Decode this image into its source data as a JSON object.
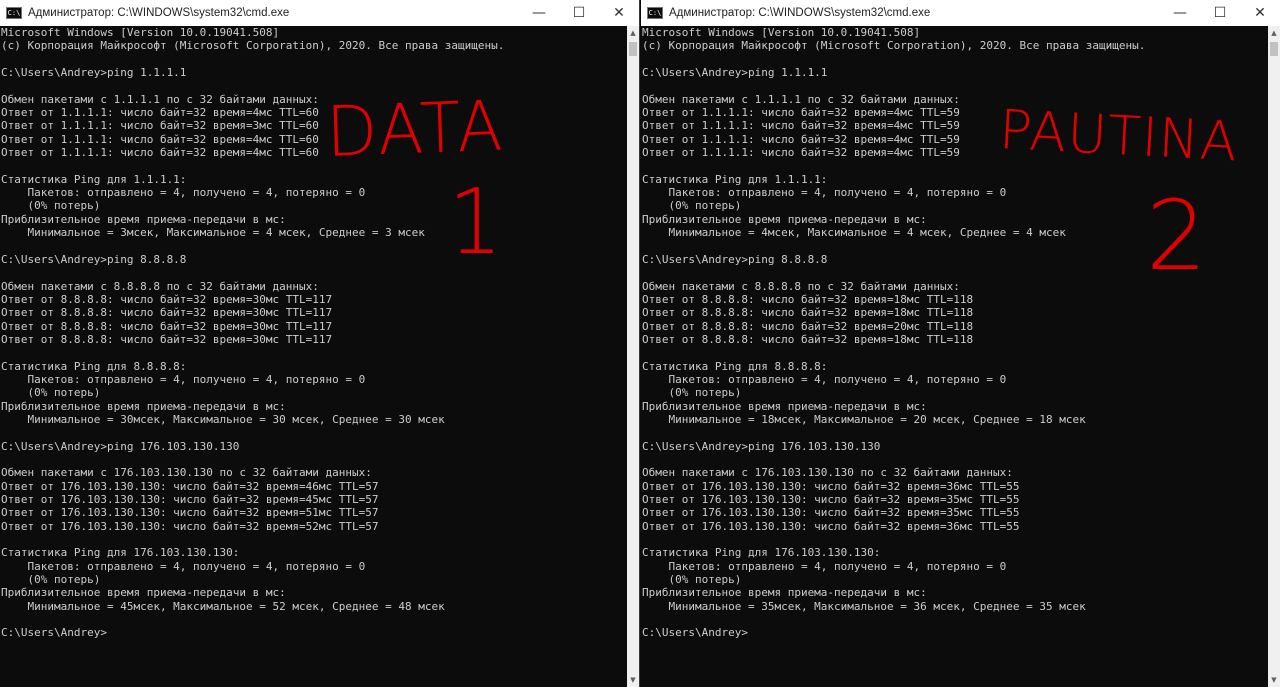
{
  "left_window": {
    "title": "Администратор: C:\\WINDOWS\\system32\\cmd.exe",
    "icon": "console-icon",
    "lines": [
      "Microsoft Windows [Version 10.0.19041.508]",
      "(c) Корпорация Майкрософт (Microsoft Corporation), 2020. Все права защищены.",
      "",
      "C:\\Users\\Andrey>ping 1.1.1.1",
      "",
      "Обмен пакетами с 1.1.1.1 по с 32 байтами данных:",
      "Ответ от 1.1.1.1: число байт=32 время=4мс TTL=60",
      "Ответ от 1.1.1.1: число байт=32 время=3мс TTL=60",
      "Ответ от 1.1.1.1: число байт=32 время=4мс TTL=60",
      "Ответ от 1.1.1.1: число байт=32 время=4мс TTL=60",
      "",
      "Статистика Ping для 1.1.1.1:",
      "    Пакетов: отправлено = 4, получено = 4, потеряно = 0",
      "    (0% потерь)",
      "Приблизительное время приема-передачи в мс:",
      "    Минимальное = 3мсек, Максимальное = 4 мсек, Среднее = 3 мсек",
      "",
      "C:\\Users\\Andrey>ping 8.8.8.8",
      "",
      "Обмен пакетами с 8.8.8.8 по с 32 байтами данных:",
      "Ответ от 8.8.8.8: число байт=32 время=30мс TTL=117",
      "Ответ от 8.8.8.8: число байт=32 время=30мс TTL=117",
      "Ответ от 8.8.8.8: число байт=32 время=30мс TTL=117",
      "Ответ от 8.8.8.8: число байт=32 время=30мс TTL=117",
      "",
      "Статистика Ping для 8.8.8.8:",
      "    Пакетов: отправлено = 4, получено = 4, потеряно = 0",
      "    (0% потерь)",
      "Приблизительное время приема-передачи в мс:",
      "    Минимальное = 30мсек, Максимальное = 30 мсек, Среднее = 30 мсек",
      "",
      "C:\\Users\\Andrey>ping 176.103.130.130",
      "",
      "Обмен пакетами с 176.103.130.130 по с 32 байтами данных:",
      "Ответ от 176.103.130.130: число байт=32 время=46мс TTL=57",
      "Ответ от 176.103.130.130: число байт=32 время=45мс TTL=57",
      "Ответ от 176.103.130.130: число байт=32 время=51мс TTL=57",
      "Ответ от 176.103.130.130: число байт=32 время=52мс TTL=57",
      "",
      "Статистика Ping для 176.103.130.130:",
      "    Пакетов: отправлено = 4, получено = 4, потеряно = 0",
      "    (0% потерь)",
      "Приблизительное время приема-передачи в мс:",
      "    Минимальное = 45мсек, Максимальное = 52 мсек, Среднее = 48 мсек",
      "",
      "C:\\Users\\Andrey>"
    ],
    "annotation_line1": "DATA",
    "annotation_line2": "1"
  },
  "right_window": {
    "title": "Администратор: C:\\WINDOWS\\system32\\cmd.exe",
    "icon": "console-icon",
    "lines": [
      "Microsoft Windows [Version 10.0.19041.508]",
      "(c) Корпорация Майкрософт (Microsoft Corporation), 2020. Все права защищены.",
      "",
      "C:\\Users\\Andrey>ping 1.1.1.1",
      "",
      "Обмен пакетами с 1.1.1.1 по с 32 байтами данных:",
      "Ответ от 1.1.1.1: число байт=32 время=4мс TTL=59",
      "Ответ от 1.1.1.1: число байт=32 время=4мс TTL=59",
      "Ответ от 1.1.1.1: число байт=32 время=4мс TTL=59",
      "Ответ от 1.1.1.1: число байт=32 время=4мс TTL=59",
      "",
      "Статистика Ping для 1.1.1.1:",
      "    Пакетов: отправлено = 4, получено = 4, потеряно = 0",
      "    (0% потерь)",
      "Приблизительное время приема-передачи в мс:",
      "    Минимальное = 4мсек, Максимальное = 4 мсек, Среднее = 4 мсек",
      "",
      "C:\\Users\\Andrey>ping 8.8.8.8",
      "",
      "Обмен пакетами с 8.8.8.8 по с 32 байтами данных:",
      "Ответ от 8.8.8.8: число байт=32 время=18мс TTL=118",
      "Ответ от 8.8.8.8: число байт=32 время=18мс TTL=118",
      "Ответ от 8.8.8.8: число байт=32 время=20мс TTL=118",
      "Ответ от 8.8.8.8: число байт=32 время=18мс TTL=118",
      "",
      "Статистика Ping для 8.8.8.8:",
      "    Пакетов: отправлено = 4, получено = 4, потеряно = 0",
      "    (0% потерь)",
      "Приблизительное время приема-передачи в мс:",
      "    Минимальное = 18мсек, Максимальное = 20 мсек, Среднее = 18 мсек",
      "",
      "C:\\Users\\Andrey>ping 176.103.130.130",
      "",
      "Обмен пакетами с 176.103.130.130 по с 32 байтами данных:",
      "Ответ от 176.103.130.130: число байт=32 время=36мс TTL=55",
      "Ответ от 176.103.130.130: число байт=32 время=35мс TTL=55",
      "Ответ от 176.103.130.130: число байт=32 время=35мс TTL=55",
      "Ответ от 176.103.130.130: число байт=32 время=36мс TTL=55",
      "",
      "Статистика Ping для 176.103.130.130:",
      "    Пакетов: отправлено = 4, получено = 4, потеряно = 0",
      "    (0% потерь)",
      "Приблизительное время приема-передачи в мс:",
      "    Минимальное = 35мсек, Максимальное = 36 мсек, Среднее = 35 мсек",
      "",
      "C:\\Users\\Andrey>"
    ],
    "annotation_line1": "PAUTINA",
    "annotation_line2": "2"
  },
  "window_buttons": {
    "minimize": "—",
    "maximize": "☐",
    "close": "✕"
  },
  "scrollbar": {
    "up_arrow": "▲",
    "down_arrow": "▼"
  },
  "colors": {
    "console_bg": "#0c0c0c",
    "console_text": "#cccccc",
    "annotation": "#e00000",
    "titlebar_active": "#ffffff"
  }
}
